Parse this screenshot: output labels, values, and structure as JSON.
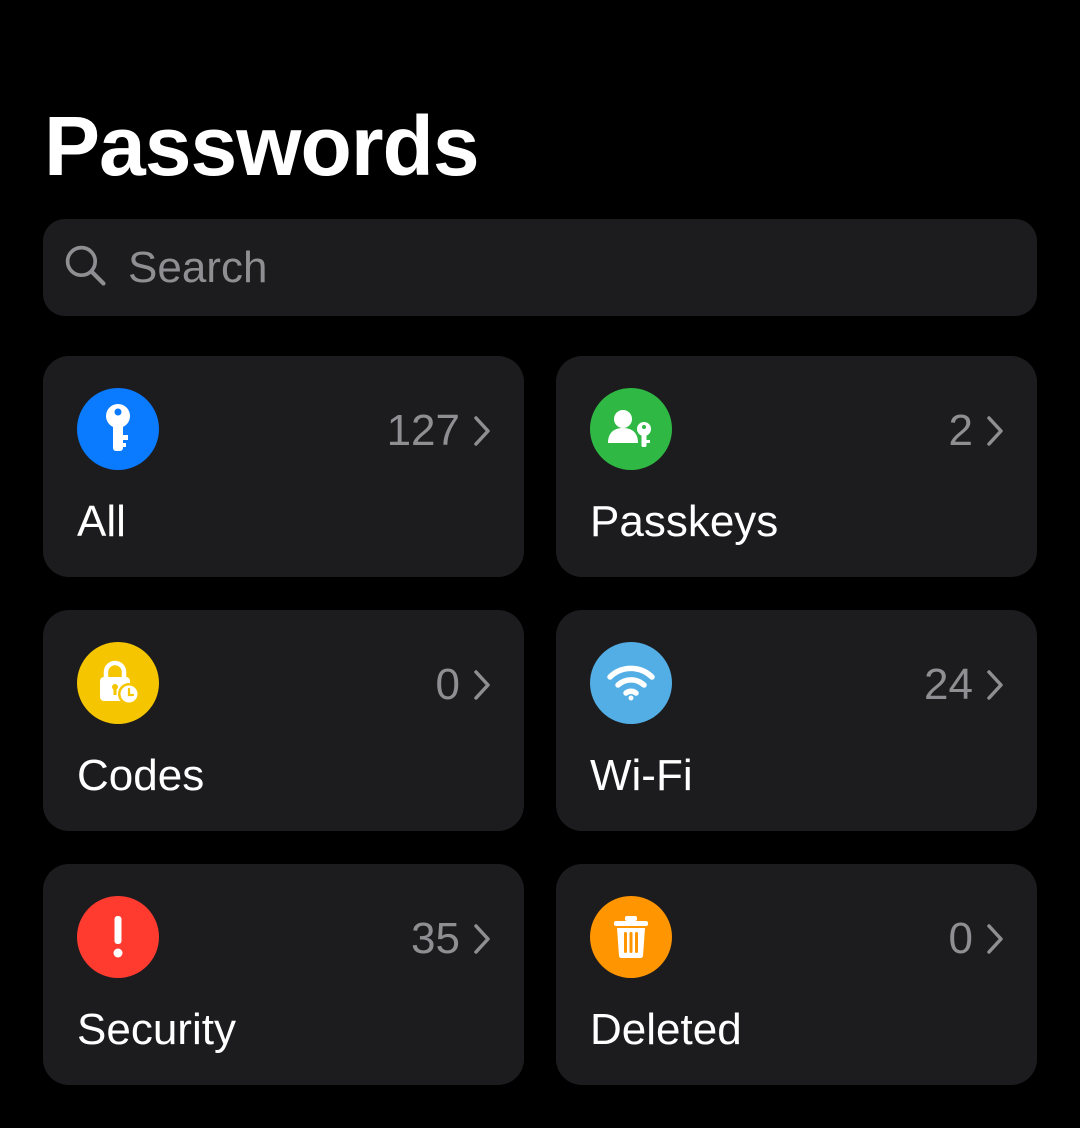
{
  "header": {
    "title": "Passwords"
  },
  "search": {
    "placeholder": "Search",
    "icon": "search-icon"
  },
  "categories": [
    {
      "label": "All",
      "count": "127",
      "icon": "key-icon",
      "color": "#0a7aff"
    },
    {
      "label": "Passkeys",
      "count": "2",
      "icon": "person-key-icon",
      "color": "#2fb944"
    },
    {
      "label": "Codes",
      "count": "0",
      "icon": "lock-clock-icon",
      "color": "#f5c600"
    },
    {
      "label": "Wi-Fi",
      "count": "24",
      "icon": "wifi-icon",
      "color": "#52aee4"
    },
    {
      "label": "Security",
      "count": "35",
      "icon": "exclamation-icon",
      "color": "#ff3b30"
    },
    {
      "label": "Deleted",
      "count": "0",
      "icon": "trash-icon",
      "color": "#ff9500"
    }
  ],
  "colors": {
    "background": "#000000",
    "tile_background": "#1c1c1e",
    "secondary_text": "#8e8e93"
  }
}
